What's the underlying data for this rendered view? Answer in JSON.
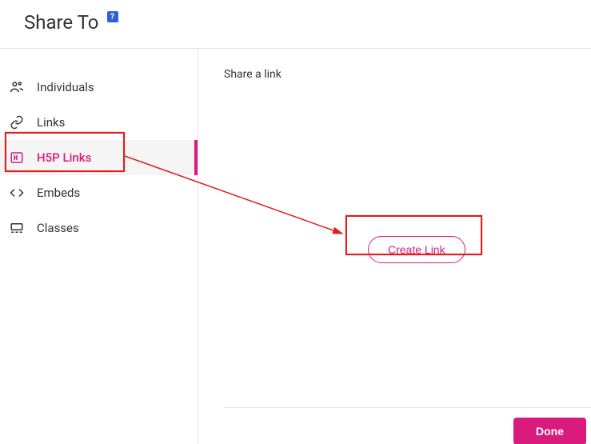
{
  "header": {
    "title": "Share To",
    "help_badge": "?"
  },
  "sidebar": {
    "items": [
      {
        "label": "Individuals",
        "selected": false
      },
      {
        "label": "Links",
        "selected": false
      },
      {
        "label": "H5P Links",
        "selected": true
      },
      {
        "label": "Embeds",
        "selected": false
      },
      {
        "label": "Classes",
        "selected": false
      }
    ]
  },
  "main": {
    "title": "Share a link",
    "create_button": "Create Link"
  },
  "footer": {
    "done_button": "Done"
  },
  "colors": {
    "accent": "#d81b7c",
    "highlight_red": "#e11d1d"
  }
}
